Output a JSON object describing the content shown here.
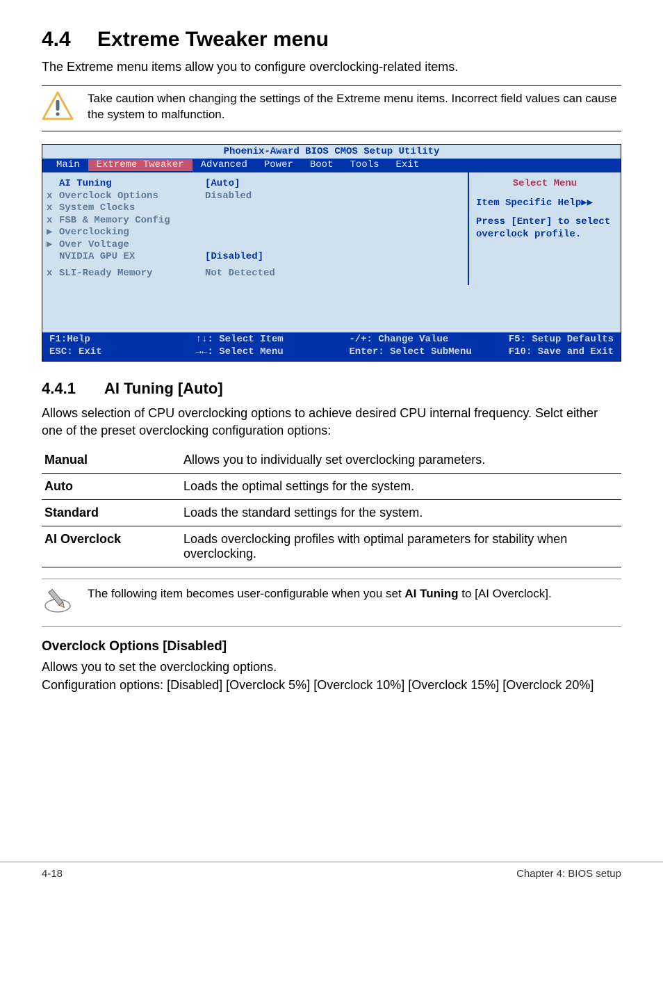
{
  "page": {
    "section_number": "4.4",
    "section_title": "Extreme Tweaker menu",
    "intro": "The Extreme menu items allow you to configure overclocking-related items.",
    "caution_note": "Take caution when changing the settings of the Extreme menu items. Incorrect field values can cause the system to malfunction."
  },
  "bios": {
    "title": "Phoenix-Award BIOS CMOS Setup Utility",
    "tabs": [
      "Main",
      "Extreme Tweaker",
      "Advanced",
      "Power",
      "Boot",
      "Tools",
      "Exit"
    ],
    "active_tab_index": 1,
    "items": [
      {
        "mark": "",
        "label": "AI Tuning",
        "value": "[Auto]",
        "first": true
      },
      {
        "mark": "x",
        "label": "Overclock Options",
        "value": "Disabled"
      },
      {
        "mark": "x",
        "label": "System Clocks",
        "value": ""
      },
      {
        "mark": "x",
        "label": "FSB & Memory Config",
        "value": ""
      },
      {
        "mark": "▶",
        "label": "Overclocking",
        "value": ""
      },
      {
        "mark": "▶",
        "label": "Over Voltage",
        "value": ""
      },
      {
        "mark": "",
        "label": "NVIDIA GPU EX",
        "value": "[Disabled]",
        "nvidia": true
      },
      {
        "mark": "x",
        "label": "SLI-Ready Memory",
        "value": "    Not Detected",
        "sli": true
      }
    ],
    "help_panel": {
      "select_menu": "Select Menu",
      "item_specific": "Item Specific Help▶▶",
      "help_text": "Press [Enter] to select overclock profile."
    },
    "footer": {
      "c1a": "F1:Help",
      "c1b": "↑↓: Select Item",
      "c1c": "-/+: Change Value",
      "c1d": "F5: Setup Defaults",
      "c2a": "ESC: Exit",
      "c2b": "→←: Select Menu",
      "c2c": "Enter: Select SubMenu",
      "c2d": "F10: Save and Exit"
    }
  },
  "subsection": {
    "number": "4.4.1",
    "title": "AI Tuning [Auto]",
    "desc": "Allows selection of CPU overclocking options to achieve desired CPU internal frequency. Selct either one of the preset overclocking configuration options:",
    "options": [
      {
        "key": "Manual",
        "desc": "Allows you to individually set overclocking parameters."
      },
      {
        "key": "Auto",
        "desc": "Loads the optimal settings for the system."
      },
      {
        "key": "Standard",
        "desc": "Loads the standard settings for the system."
      },
      {
        "key": "AI Overclock",
        "desc": "Loads overclocking profiles with optimal parameters for stability when overclocking."
      }
    ],
    "pencil_note_pre": "The following item becomes user-configurable when you set ",
    "pencil_note_bold": "AI Tuning",
    "pencil_note_post": " to [AI Overclock].",
    "oc_options_heading": "Overclock Options [Disabled]",
    "oc_options_line1": "Allows you to set the overclocking options.",
    "oc_options_line2": "Configuration options: [Disabled] [Overclock 5%] [Overclock 10%] [Overclock 15%] [Overclock 20%]"
  },
  "footer": {
    "left": "4-18",
    "right": "Chapter 4: BIOS setup"
  }
}
